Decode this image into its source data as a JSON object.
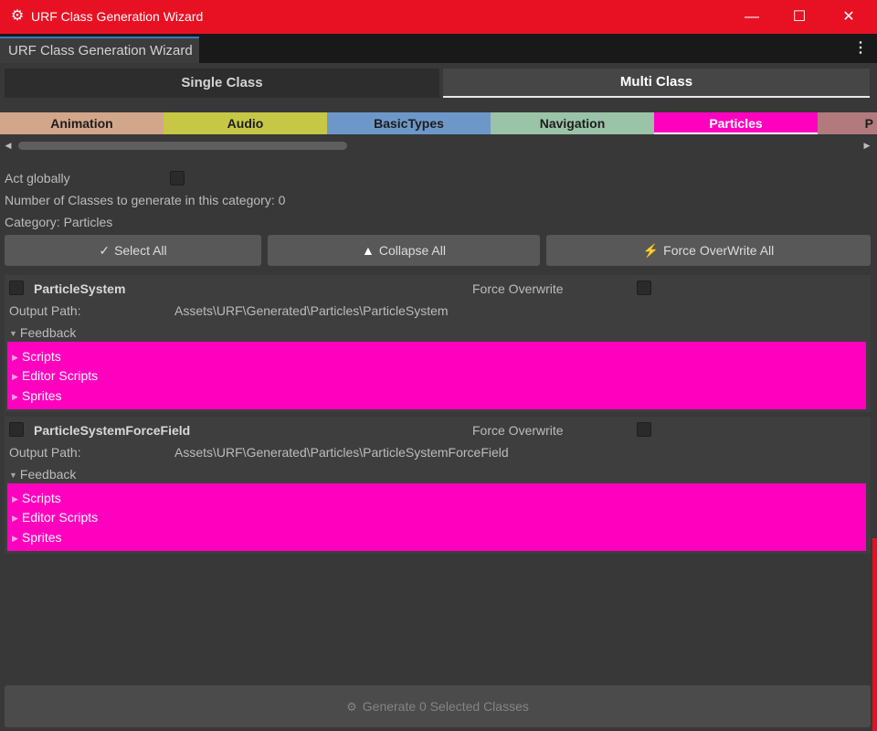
{
  "window": {
    "title": "URF Class Generation Wizard",
    "controls": {
      "minimize": "—",
      "maximize": "☐",
      "close": "✕"
    }
  },
  "editor_tab": {
    "label": "URF Class Generation Wizard",
    "menu": "⋮"
  },
  "modes": [
    {
      "label": "Single Class",
      "selected": false
    },
    {
      "label": "Multi Class",
      "selected": true
    }
  ],
  "categories": [
    {
      "label": "Animation",
      "color": "#d2a68b"
    },
    {
      "label": "Audio",
      "color": "#c6c745"
    },
    {
      "label": "BasicTypes",
      "color": "#6e97c9"
    },
    {
      "label": "Navigation",
      "color": "#9ac3a8"
    },
    {
      "label": "Particles",
      "color": "#ff00bf",
      "selected": true
    },
    {
      "label": "P",
      "color": "#b27a7d"
    }
  ],
  "settings": {
    "act_globally_label": "Act globally",
    "count_label": "Number of Classes to generate in this category: 0",
    "category_label": "Category: Particles"
  },
  "actions": {
    "select_all": {
      "icon": "✓",
      "label": "Select All"
    },
    "collapse_all": {
      "icon": "▲",
      "label": "Collapse All"
    },
    "force_overwrite_all": {
      "icon": "⚡",
      "label": "Force OverWrite All"
    }
  },
  "classes": [
    {
      "name": "ParticleSystem",
      "force_overwrite_label": "Force Overwrite",
      "output_path_label": "Output Path:",
      "output_path": "Assets\\URF\\Generated\\Particles\\ParticleSystem",
      "feedback_label": "Feedback",
      "feedback_items": [
        "Scripts",
        "Editor Scripts",
        "Sprites"
      ]
    },
    {
      "name": "ParticleSystemForceField",
      "force_overwrite_label": "Force Overwrite",
      "output_path_label": "Output Path:",
      "output_path": "Assets\\URF\\Generated\\Particles\\ParticleSystemForceField",
      "feedback_label": "Feedback",
      "feedback_items": [
        "Scripts",
        "Editor Scripts",
        "Sprites"
      ]
    }
  ],
  "generate": {
    "icon": "⚙",
    "label": "Generate 0 Selected Classes"
  },
  "colors": {
    "title_bar": "#e81123",
    "accent": "#ff00bf"
  }
}
